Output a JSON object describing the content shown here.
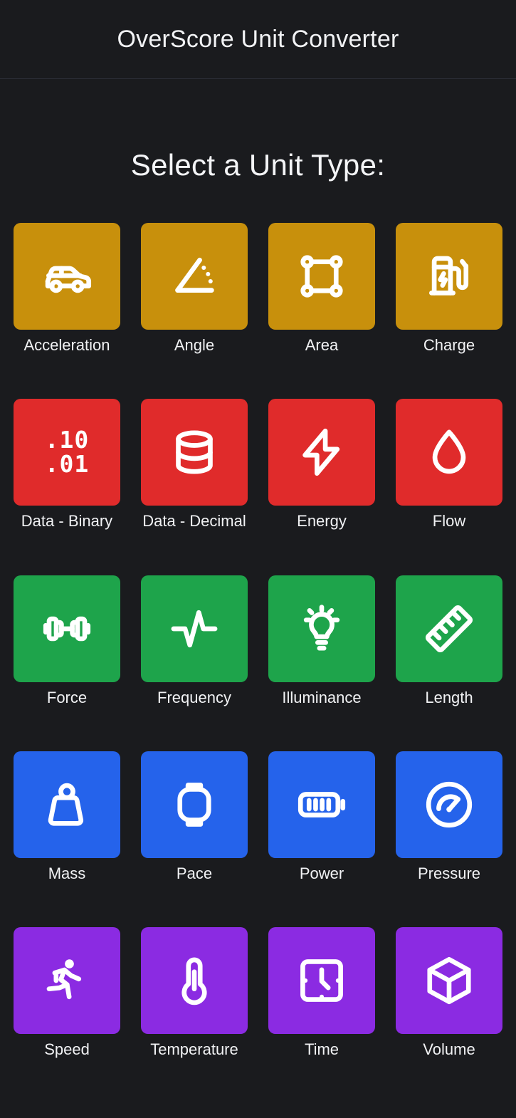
{
  "header": {
    "title": "OverScore Unit Converter"
  },
  "main": {
    "heading": "Select a Unit Type:"
  },
  "colors": {
    "background": "#1a1b1e",
    "divider": "#2b2e36",
    "text": "#f1f2f4",
    "amber": "#c8900c",
    "red": "#e02b2b",
    "green": "#1ea44b",
    "blue": "#2563eb",
    "purple": "#8b2be2"
  },
  "unit_types": [
    {
      "label": "Acceleration",
      "icon": "car-icon",
      "color": "#c8900c"
    },
    {
      "label": "Angle",
      "icon": "angle-icon",
      "color": "#c8900c"
    },
    {
      "label": "Area",
      "icon": "area-square-icon",
      "color": "#c8900c"
    },
    {
      "label": "Charge",
      "icon": "ev-charger-icon",
      "color": "#c8900c"
    },
    {
      "label": "Data - Binary",
      "icon": "binary-digits-icon",
      "color": "#e02b2b",
      "glyph_top": ".10",
      "glyph_bottom": ".01"
    },
    {
      "label": "Data - Decimal",
      "icon": "database-icon",
      "color": "#e02b2b"
    },
    {
      "label": "Energy",
      "icon": "lightning-bolt-icon",
      "color": "#e02b2b"
    },
    {
      "label": "Flow",
      "icon": "droplet-icon",
      "color": "#e02b2b"
    },
    {
      "label": "Force",
      "icon": "dumbbell-icon",
      "color": "#1ea44b"
    },
    {
      "label": "Frequency",
      "icon": "pulse-wave-icon",
      "color": "#1ea44b"
    },
    {
      "label": "Illuminance",
      "icon": "lightbulb-icon",
      "color": "#1ea44b"
    },
    {
      "label": "Length",
      "icon": "ruler-icon",
      "color": "#1ea44b"
    },
    {
      "label": "Mass",
      "icon": "weight-icon",
      "color": "#2563eb"
    },
    {
      "label": "Pace",
      "icon": "smartwatch-icon",
      "color": "#2563eb"
    },
    {
      "label": "Power",
      "icon": "battery-icon",
      "color": "#2563eb"
    },
    {
      "label": "Pressure",
      "icon": "gauge-icon",
      "color": "#2563eb"
    },
    {
      "label": "Speed",
      "icon": "running-person-icon",
      "color": "#8b2be2"
    },
    {
      "label": "Temperature",
      "icon": "thermometer-icon",
      "color": "#8b2be2"
    },
    {
      "label": "Time",
      "icon": "square-clock-icon",
      "color": "#8b2be2"
    },
    {
      "label": "Volume",
      "icon": "cube-icon",
      "color": "#8b2be2"
    }
  ]
}
